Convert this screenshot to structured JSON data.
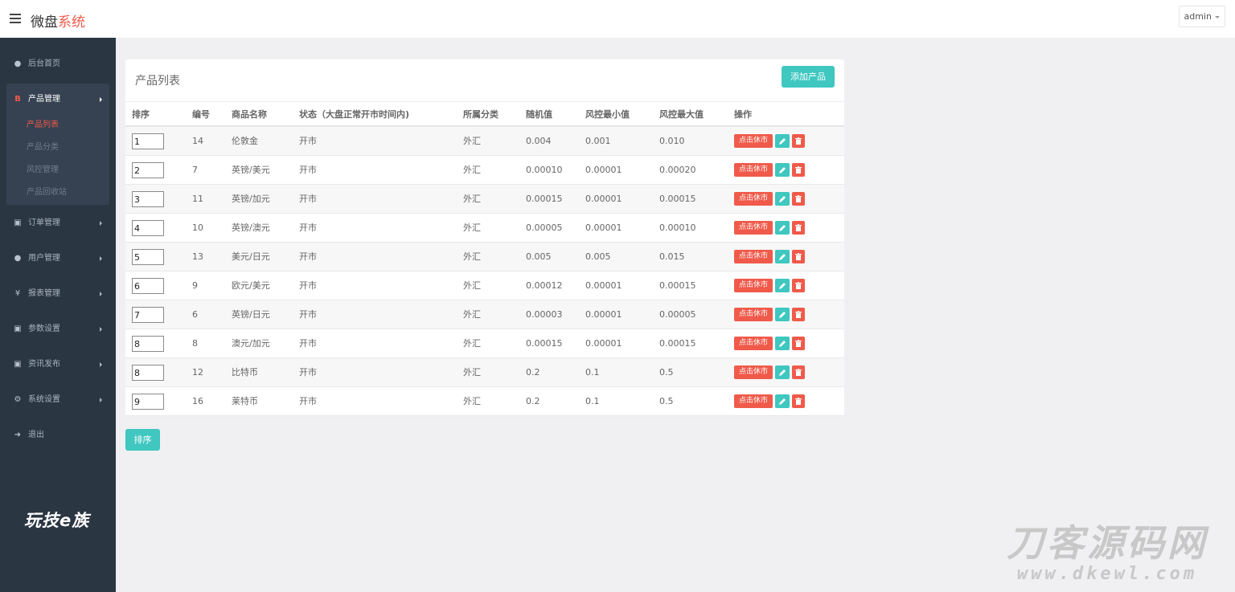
{
  "header": {
    "brand_main": "微盘",
    "brand_accent": "系统",
    "user": "admin"
  },
  "sidebar": {
    "items": [
      {
        "label": "后台首页",
        "icon": "dashboard-icon"
      },
      {
        "label": "产品管理",
        "icon": "bitcoin-icon"
      },
      {
        "label": "订单管理",
        "icon": "copy-icon"
      },
      {
        "label": "用户管理",
        "icon": "user-icon"
      },
      {
        "label": "报表管理",
        "icon": "yen-icon"
      },
      {
        "label": "参数设置",
        "icon": "copy-icon"
      },
      {
        "label": "资讯发布",
        "icon": "copy-icon"
      },
      {
        "label": "系统设置",
        "icon": "cogs-icon"
      },
      {
        "label": "退出",
        "icon": "sign-out-icon"
      }
    ],
    "subitems": [
      "产品列表",
      "产品分类",
      "风控管理",
      "产品回收站"
    ],
    "watermark": "玩技e族"
  },
  "panel": {
    "title": "产品列表",
    "add_button": "添加产品",
    "columns": [
      "排序",
      "编号",
      "商品名称",
      "状态（大盘正常开市时间内)",
      "所属分类",
      "随机值",
      "风控最小值",
      "风控最大值",
      "操作"
    ],
    "rows": [
      {
        "sort": "1",
        "id": "14",
        "name": "伦敦金",
        "status": "开市",
        "category": "外汇",
        "random": "0.004",
        "min": "0.001",
        "max": "0.010"
      },
      {
        "sort": "2",
        "id": "7",
        "name": "英镑/美元",
        "status": "开市",
        "category": "外汇",
        "random": "0.00010",
        "min": "0.00001",
        "max": "0.00020"
      },
      {
        "sort": "3",
        "id": "11",
        "name": "英镑/加元",
        "status": "开市",
        "category": "外汇",
        "random": "0.00015",
        "min": "0.00001",
        "max": "0.00015"
      },
      {
        "sort": "4",
        "id": "10",
        "name": "英镑/澳元",
        "status": "开市",
        "category": "外汇",
        "random": "0.00005",
        "min": "0.00001",
        "max": "0.00010"
      },
      {
        "sort": "5",
        "id": "13",
        "name": "美元/日元",
        "status": "开市",
        "category": "外汇",
        "random": "0.005",
        "min": "0.005",
        "max": "0.015"
      },
      {
        "sort": "6",
        "id": "9",
        "name": "欧元/美元",
        "status": "开市",
        "category": "外汇",
        "random": "0.00012",
        "min": "0.00001",
        "max": "0.00015"
      },
      {
        "sort": "7",
        "id": "6",
        "name": "英镑/日元",
        "status": "开市",
        "category": "外汇",
        "random": "0.00003",
        "min": "0.00001",
        "max": "0.00005"
      },
      {
        "sort": "8",
        "id": "8",
        "name": "澳元/加元",
        "status": "开市",
        "category": "外汇",
        "random": "0.00015",
        "min": "0.00001",
        "max": "0.00015"
      },
      {
        "sort": "8",
        "id": "12",
        "name": "比特币",
        "status": "开市",
        "category": "外汇",
        "random": "0.2",
        "min": "0.1",
        "max": "0.5"
      },
      {
        "sort": "9",
        "id": "16",
        "name": "莱特币",
        "status": "开市",
        "category": "外汇",
        "random": "0.2",
        "min": "0.1",
        "max": "0.5"
      }
    ],
    "action_close": "点击休市",
    "sort_button": "排序"
  },
  "watermark": {
    "title": "刀客源码网",
    "url": "www.dkewl.com"
  },
  "colors": {
    "accent_red": "#f05a4a",
    "accent_teal": "#3fc7c0",
    "sidebar_bg": "#2b3643"
  }
}
